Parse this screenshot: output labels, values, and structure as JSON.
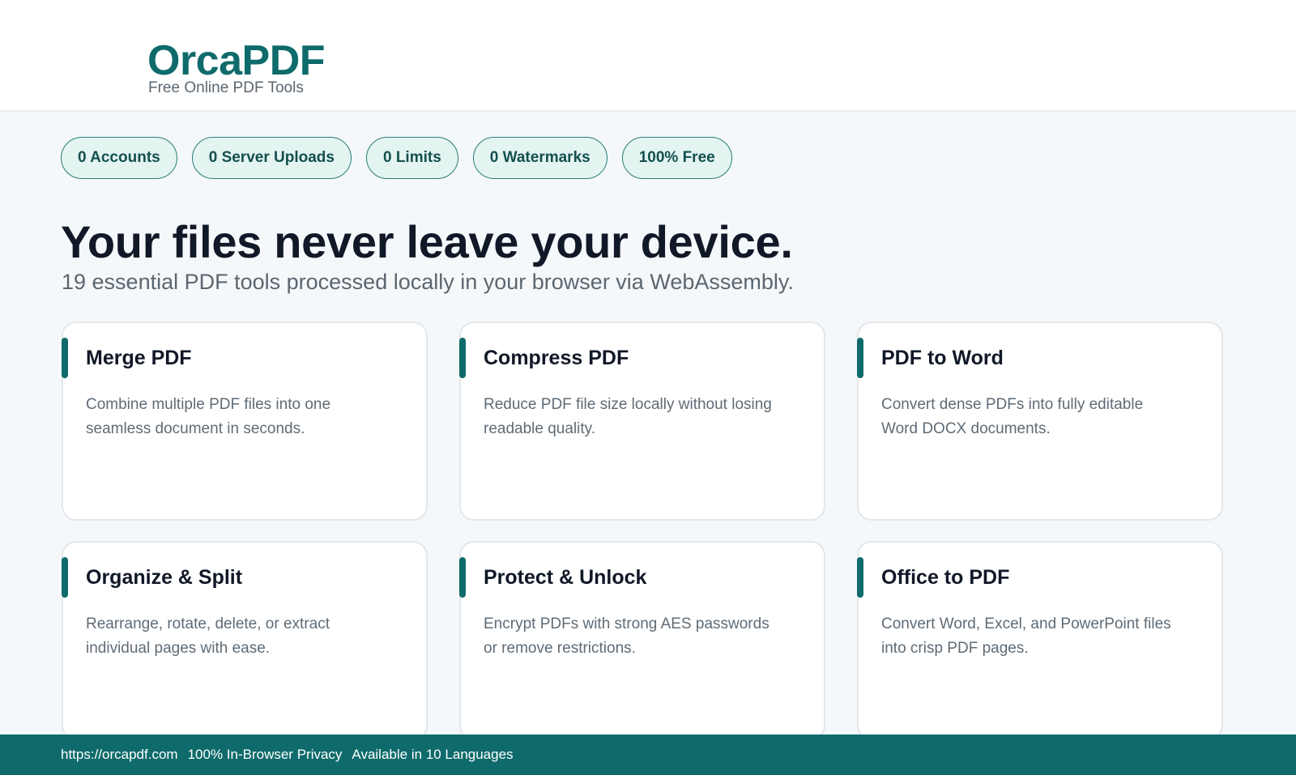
{
  "header": {
    "logo": "OrcaPDF",
    "tagline": "Free Online PDF Tools"
  },
  "badges": [
    "0 Accounts",
    "0 Server Uploads",
    "0 Limits",
    "0 Watermarks",
    "100% Free"
  ],
  "hero": {
    "title": "Your files never leave your device.",
    "subtitle": "19 essential PDF tools processed locally in your browser via WebAssembly."
  },
  "tools": [
    {
      "title": "Merge PDF",
      "desc": "Combine multiple PDF files into one seamless document in seconds."
    },
    {
      "title": "Compress PDF",
      "desc": "Reduce PDF file size locally without losing readable quality."
    },
    {
      "title": "PDF to Word",
      "desc": "Convert dense PDFs into fully editable Word DOCX documents."
    },
    {
      "title": "Organize & Split",
      "desc": "Rearrange, rotate, delete, or extract individual pages with ease."
    },
    {
      "title": "Protect & Unlock",
      "desc": "Encrypt PDFs with strong AES passwords or remove restrictions."
    },
    {
      "title": "Office to PDF",
      "desc": "Convert Word, Excel, and PowerPoint files into crisp PDF pages."
    }
  ],
  "footer": {
    "url": "https://orcapdf.com",
    "privacy": "100% In-Browser Privacy",
    "languages": "Available in 10 Languages"
  },
  "colors": {
    "brand": "#0f6b6b",
    "badge_bg": "#e3f4f1",
    "text_dark": "#111827",
    "text_muted": "#5f6b76"
  }
}
